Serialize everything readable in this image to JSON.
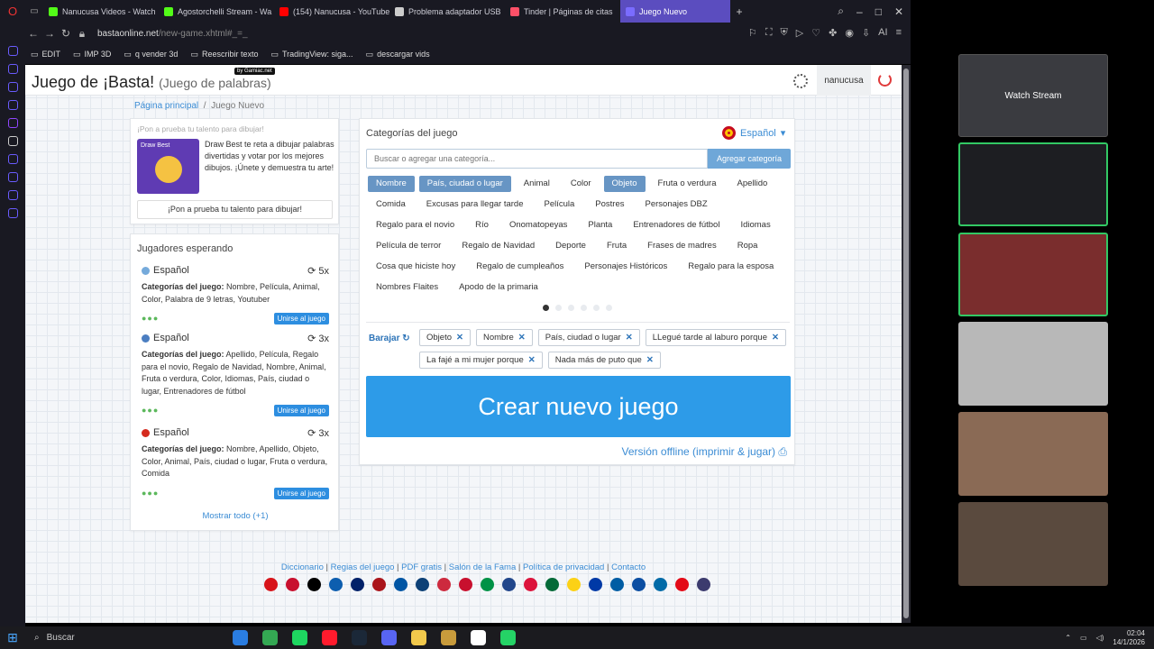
{
  "browser": {
    "tabs": [
      {
        "label": "Nanucusa Videos - Watch",
        "color": "#53fc18"
      },
      {
        "label": "Agostorchelli Stream - Wa",
        "color": "#53fc18"
      },
      {
        "label": "(154) Nanucusa - YouTube",
        "color": "#ff0000"
      },
      {
        "label": "Problema adaptador USB",
        "color": "#cccccc"
      },
      {
        "label": "Tinder | Páginas de citas",
        "color": "#fd5068"
      },
      {
        "label": "Juego Nuevo",
        "color": "#7a6cff",
        "active": true
      }
    ],
    "url_host": "bastaonline.net",
    "url_path": "/new-game.xhtml#_=_",
    "bookmarks": [
      "EDIT",
      "IMP 3D",
      "q vender 3d",
      "Reescribir texto",
      "TradingView: siga...",
      "descargar vids"
    ],
    "ai_label": "AI"
  },
  "site": {
    "title": "Juego de ¡Basta!",
    "subtitle": "(Juego de palabras)",
    "gamiac": "by Gamiac.net",
    "username": "nanucusa"
  },
  "breadcrumb": {
    "home": "Página principal",
    "sep": "/",
    "current": "Juego Nuevo"
  },
  "promo": {
    "heading": "¡Pon a prueba tu talento para dibujar!",
    "image_text": "Draw Best",
    "text": "Draw Best te reta a dibujar palabras divertidas y votar por los mejores dibujos. ¡Únete y demuestra tu arte!",
    "button": "¡Pon a prueba tu talento para dibujar!"
  },
  "waiting": {
    "heading": "Jugadores esperando",
    "cats_label": "Categorías del juego:",
    "join_label": "Unirse al juego",
    "show_all": "Mostrar todo (+1)",
    "games": [
      {
        "lang": "Español",
        "count": "5x",
        "flag_color": "#75aadb",
        "cats": "Nombre, Película, Animal, Color, Palabra de 9 letras, Youtuber"
      },
      {
        "lang": "Español",
        "count": "3x",
        "flag_color": "#4b7ec1",
        "cats": "Apellido, Película, Regalo para el novio, Regalo de Navidad, Nombre, Animal, Fruta o verdura, Color, Idiomas, País, ciudad o lugar, Entrenadores de fútbol"
      },
      {
        "lang": "Español",
        "count": "3x",
        "flag_color": "#d52b1e",
        "cats": "Nombre, Apellido, Objeto, Color, Animal, País, ciudad o lugar, Fruta o verdura, Comida"
      }
    ]
  },
  "categories": {
    "heading": "Categorías del juego",
    "language": "Español",
    "search_placeholder": "Buscar o agregar una categoría...",
    "add_button": "Agregar categoría",
    "chips": [
      {
        "label": "Nombre",
        "selected": true
      },
      {
        "label": "País, ciudad o lugar",
        "selected": true
      },
      {
        "label": "Animal",
        "selected": false
      },
      {
        "label": "Color",
        "selected": false
      },
      {
        "label": "Objeto",
        "selected": true
      },
      {
        "label": "Fruta o verdura",
        "selected": false
      },
      {
        "label": "Apellido",
        "selected": false
      },
      {
        "label": "Comida",
        "selected": false
      },
      {
        "label": "Excusas para llegar tarde",
        "selected": false
      },
      {
        "label": "Película",
        "selected": false
      },
      {
        "label": "Postres",
        "selected": false
      },
      {
        "label": "Personajes DBZ",
        "selected": false
      },
      {
        "label": "Regalo para el novio",
        "selected": false
      },
      {
        "label": "Río",
        "selected": false
      },
      {
        "label": "Onomatopeyas",
        "selected": false
      },
      {
        "label": "Planta",
        "selected": false
      },
      {
        "label": "Entrenadores de fútbol",
        "selected": false
      },
      {
        "label": "Idiomas",
        "selected": false
      },
      {
        "label": "Película de terror",
        "selected": false
      },
      {
        "label": "Regalo de Navidad",
        "selected": false
      },
      {
        "label": "Deporte",
        "selected": false
      },
      {
        "label": "Fruta",
        "selected": false
      },
      {
        "label": "Frases de madres",
        "selected": false
      },
      {
        "label": "Ropa",
        "selected": false
      },
      {
        "label": "Cosa que hiciste hoy",
        "selected": false
      },
      {
        "label": "Regalo de cumpleaños",
        "selected": false
      },
      {
        "label": "Personajes Históricos",
        "selected": false
      },
      {
        "label": "Regalo para la esposa",
        "selected": false
      },
      {
        "label": "Nombres Flaites",
        "selected": false
      },
      {
        "label": "Apodo de la primaria",
        "selected": false
      }
    ],
    "shuffle_label": "Barajar",
    "selected": [
      "Objeto",
      "Nombre",
      "País, ciudad o lugar",
      "LLegué tarde al laburo porque",
      "La fajé a mi mujer porque",
      "Nada más de puto que"
    ],
    "create_button": "Crear nuevo juego",
    "offline_link": "Versión offline (imprimir & jugar)"
  },
  "footer": {
    "links": [
      "Diccionario",
      "Regias del juego",
      "PDF gratis",
      "Salón de la Fama",
      "Política de privacidad",
      "Contacto"
    ],
    "flag_colors": [
      "#d7141a",
      "#c8102e",
      "#000000",
      "#0d5eaf",
      "#012169",
      "#aa151b",
      "#0055a4",
      "#0c4076",
      "#cd2a3e",
      "#c8102e",
      "#009246",
      "#21468b",
      "#dc143c",
      "#046a38",
      "#fcd116",
      "#0039a6",
      "#005da4",
      "#0b4ea2",
      "#006aa7",
      "#e30a17",
      "#3c3b6e"
    ]
  },
  "stream": {
    "watch_label": "Watch Stream"
  },
  "taskbar": {
    "search": "Buscar",
    "time": "02:04",
    "date": "14/1/2026",
    "app_colors": [
      "#2a7de1",
      "#34a853",
      "#1ed760",
      "#ff1b2d",
      "#1b2838",
      "#5865f2",
      "#f2c94c",
      "#c89b3c",
      "#ffffff",
      "#25d366"
    ]
  }
}
